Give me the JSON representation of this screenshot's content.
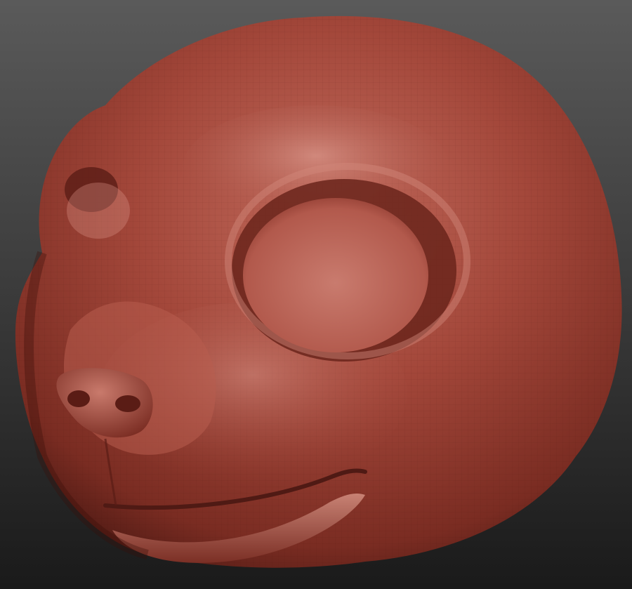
{
  "scene": {
    "subject": "head-sculpt",
    "material_color": "#a3473a",
    "highlight_color": "#d28a7c",
    "shadow_color": "#4f1a14",
    "background_top": "#5a5a5a",
    "background_bottom": "#1a1a1a"
  }
}
